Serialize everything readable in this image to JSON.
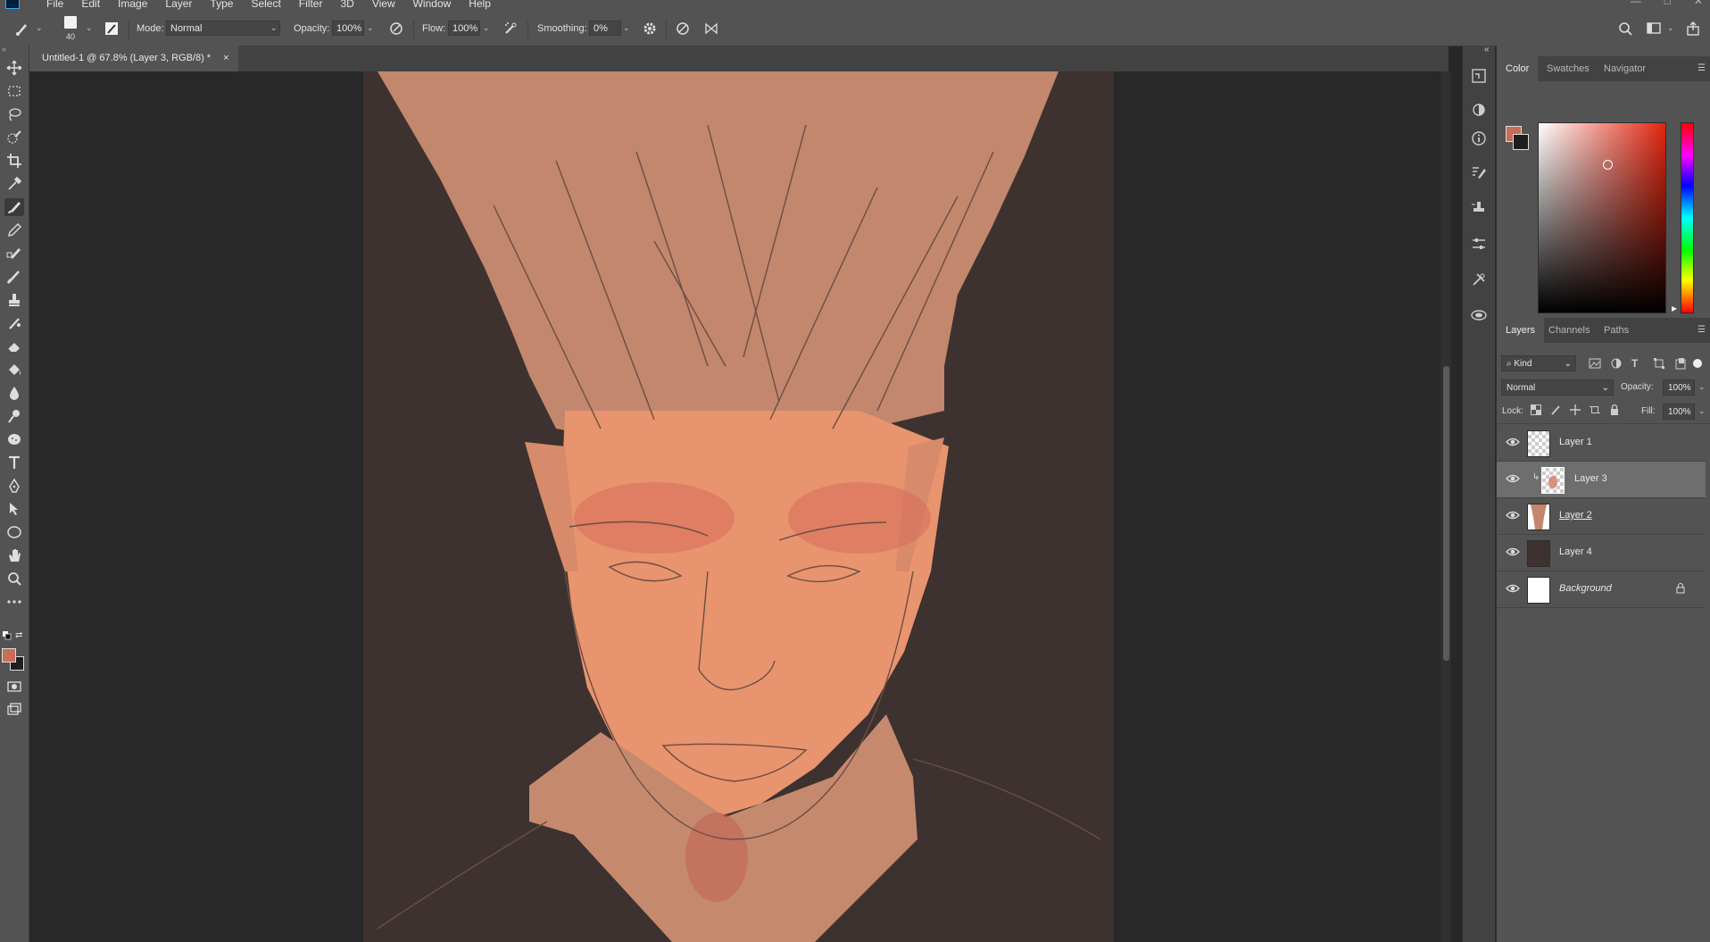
{
  "menu": {
    "items": [
      "File",
      "Edit",
      "Image",
      "Layer",
      "Type",
      "Select",
      "Filter",
      "3D",
      "View",
      "Window",
      "Help"
    ]
  },
  "options": {
    "brush_size": "40",
    "mode_label": "Mode:",
    "mode_value": "Normal",
    "opacity_label": "Opacity:",
    "opacity_value": "100%",
    "flow_label": "Flow:",
    "flow_value": "100%",
    "smoothing_label": "Smoothing:",
    "smoothing_value": "0%"
  },
  "document": {
    "tab_title": "Untitled-1 @ 67.8% (Layer 3, RGB/8) *",
    "close": "×"
  },
  "colors": {
    "foreground": "#c96d59",
    "background": "#1f1f1f",
    "canvas_bg": "#3d3230",
    "skin": "#e8946e"
  },
  "color_panel": {
    "tabs": [
      "Color",
      "Swatches",
      "Navigator"
    ],
    "active_tab": "Color"
  },
  "layers_panel": {
    "tabs": [
      "Layers",
      "Channels",
      "Paths"
    ],
    "kind_label": "Kind",
    "blend_mode": "Normal",
    "opacity_label": "Opacity:",
    "opacity_value": "100%",
    "lock_label": "Lock:",
    "fill_label": "Fill:",
    "fill_value": "100%",
    "layers": [
      {
        "name": "Layer 1",
        "selected": false
      },
      {
        "name": "Layer 3",
        "selected": true
      },
      {
        "name": "Layer 2",
        "selected": false
      },
      {
        "name": "Layer 4",
        "selected": false
      },
      {
        "name": "Background",
        "selected": false,
        "locked": true
      }
    ]
  }
}
